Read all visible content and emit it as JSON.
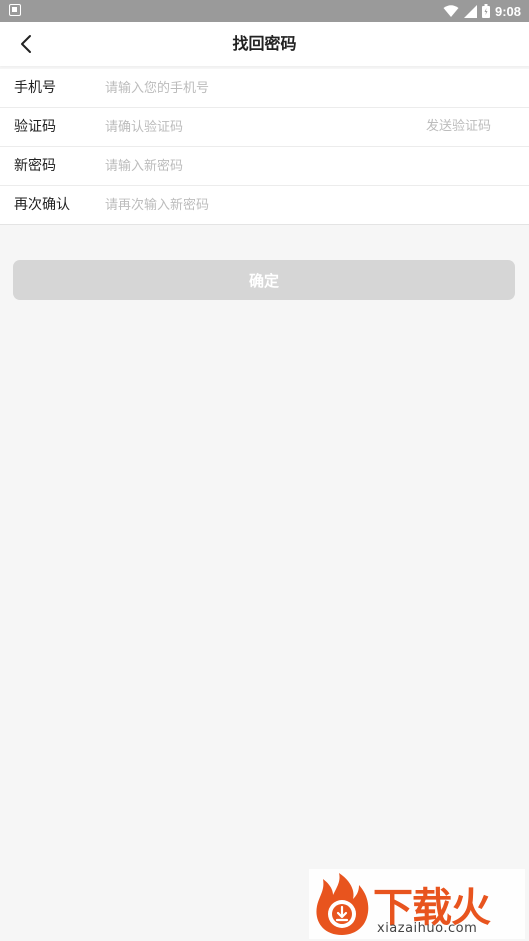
{
  "status_bar": {
    "time": "9:08"
  },
  "header": {
    "title": "找回密码"
  },
  "form": {
    "rows": [
      {
        "label": "手机号",
        "placeholder": "请输入您的手机号"
      },
      {
        "label": "验证码",
        "placeholder": "请确认验证码",
        "action": "发送验证码"
      },
      {
        "label": "新密码",
        "placeholder": "请输入新密码"
      },
      {
        "label": "再次确认",
        "placeholder": "请再次输入新密码"
      }
    ]
  },
  "confirm_button": {
    "label": "确定"
  },
  "watermark": {
    "text": "下载火",
    "url": "xiazaihuo.com"
  },
  "colors": {
    "accent": "#e8541e",
    "button_disabled": "#d6d6d6",
    "placeholder": "#bcbcbc"
  }
}
